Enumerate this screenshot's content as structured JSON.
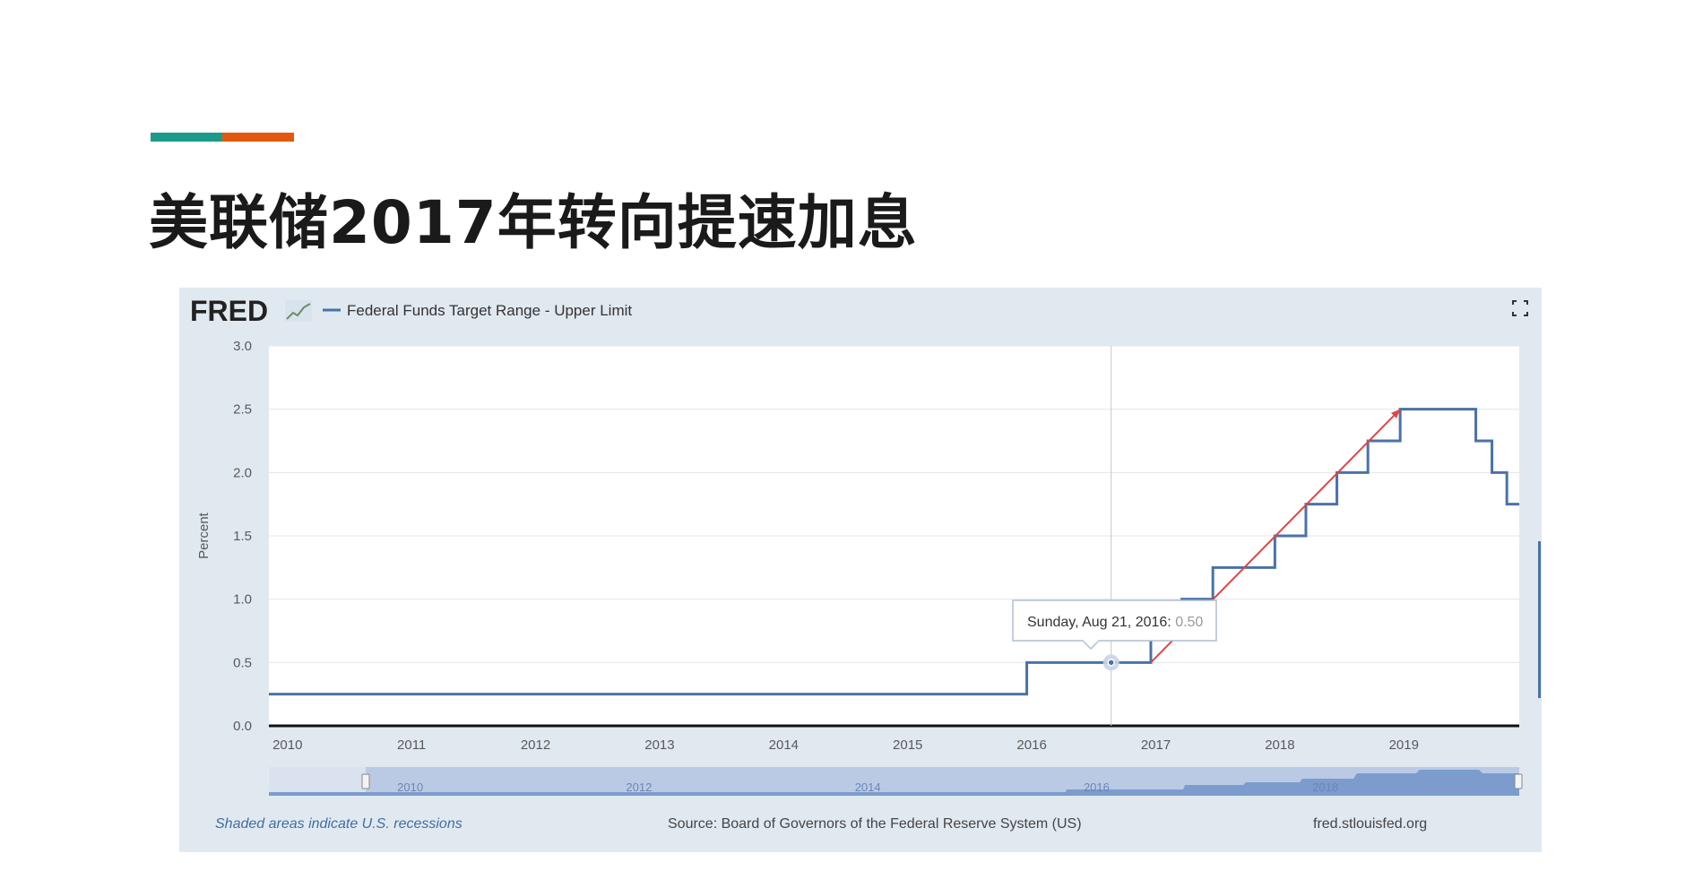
{
  "slide": {
    "title": "美联储2017年转向提速加息",
    "accent_colors": [
      "#1b9a8c",
      "#e2590e"
    ]
  },
  "fred": {
    "logo_text": "FRED",
    "legend_label": "Federal Funds Target Range - Upper Limit",
    "footer_note": "Shaded areas indicate U.S. recessions",
    "source": "Source: Board of Governors of the Federal Reserve System (US)",
    "site": "fred.stlouisfed.org",
    "tooltip": {
      "date": "Sunday, Aug 21, 2016:",
      "value": "0.50"
    },
    "navigator_labels": [
      "2010",
      "2012",
      "2014",
      "2016",
      "2018"
    ]
  },
  "chart_data": {
    "type": "line",
    "title": "",
    "xlabel": "",
    "ylabel": "Percent",
    "xlim": [
      2009.85,
      2019.93
    ],
    "ylim": [
      0,
      3.0
    ],
    "y_ticks": [
      "0.0",
      "0.5",
      "1.0",
      "1.5",
      "2.0",
      "2.5",
      "3.0"
    ],
    "x_ticks": [
      "2010",
      "2011",
      "2012",
      "2013",
      "2014",
      "2015",
      "2016",
      "2017",
      "2018",
      "2019"
    ],
    "grid": true,
    "series": [
      {
        "name": "Federal Funds Target Range - Upper Limit",
        "color": "#4a72a8",
        "step": true,
        "points": [
          [
            2009.85,
            0.25
          ],
          [
            2015.96,
            0.5
          ],
          [
            2016.96,
            0.75
          ],
          [
            2017.21,
            1.0
          ],
          [
            2017.46,
            1.25
          ],
          [
            2017.96,
            1.5
          ],
          [
            2018.21,
            1.75
          ],
          [
            2018.46,
            2.0
          ],
          [
            2018.71,
            2.25
          ],
          [
            2018.97,
            2.5
          ],
          [
            2019.58,
            2.25
          ],
          [
            2019.71,
            2.0
          ],
          [
            2019.83,
            1.75
          ],
          [
            2019.93,
            1.75
          ]
        ]
      }
    ],
    "annotations": [
      {
        "type": "trend-line",
        "color": "#e04545",
        "from": [
          2016.96,
          0.5
        ],
        "to": [
          2018.97,
          2.5
        ]
      },
      {
        "type": "crosshair",
        "x": 2016.64,
        "y": 0.5
      }
    ]
  }
}
